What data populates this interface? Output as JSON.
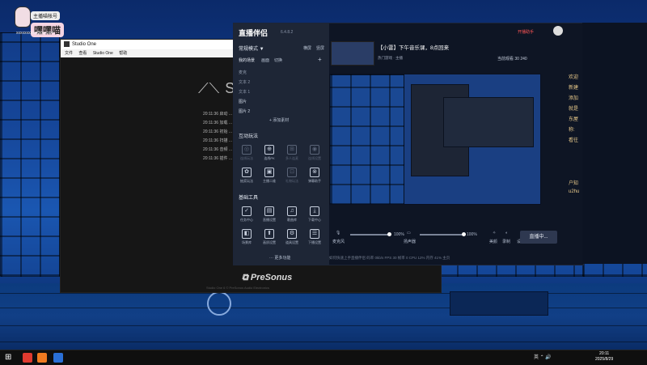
{
  "avatar": {
    "top_line": "主播喵帐号",
    "name": "嘿嘿喵",
    "email": "xxxxxxxxxx@qq.com"
  },
  "studio": {
    "title": "Studio One",
    "menu": [
      "文件",
      "查看",
      "Studio One",
      "帮助"
    ],
    "logo": "S",
    "logs": [
      "20:11:36  启动 ...",
      "20:11:36  加载 ...",
      "20:11:36  初始 ...",
      "20:11:36  扫描 ...",
      "20:11:36  音频 ...",
      "20:11:36  插件 ..."
    ],
    "brand": "PreSonus",
    "footer": "Studio One 6 © PreSonus Audio Electronics"
  },
  "live": {
    "logo": "直播伴侣",
    "version": "6.4.8.2",
    "mode": "常规模式 ▼",
    "mode_tabs": [
      "横屏",
      "竖屏"
    ],
    "scenes_label": "我的场景",
    "scene_tabs": [
      "画面",
      "切换"
    ],
    "scene_rows": [
      "麦克",
      "文本 2",
      "文本 1",
      "图片",
      "图片 2"
    ],
    "add_scene": "+ 添加素材",
    "interact_title": "互动玩法",
    "interact_tools": [
      {
        "icon": "◎",
        "label": "连线玩法",
        "dim": true
      },
      {
        "icon": "⊕",
        "label": "连线PK",
        "dim": false
      },
      {
        "icon": "⊞",
        "label": "多人连麦",
        "dim": true
      },
      {
        "icon": "◉",
        "label": "连线设置",
        "dim": true
      },
      {
        "icon": "✿",
        "label": "抽奖玩法",
        "dim": false
      },
      {
        "icon": "▣",
        "label": "主播二维",
        "dim": false
      },
      {
        "icon": "⊡",
        "label": "礼物玩法",
        "dim": true
      },
      {
        "icon": "⊗",
        "label": "弹幕助手",
        "dim": false
      }
    ],
    "basic_title": "基础工具",
    "basic_tools": [
      {
        "icon": "✓",
        "label": "任务中心",
        "dim": false
      },
      {
        "icon": "▤",
        "label": "直播设置",
        "dim": false
      },
      {
        "icon": "♫",
        "label": "歌曲库",
        "dim": false
      },
      {
        "icon": "⤓",
        "label": "下载中心",
        "dim": false
      },
      {
        "icon": "◧",
        "label": "场景库",
        "dim": false
      },
      {
        "icon": "⬆",
        "label": "画质设置",
        "dim": false
      },
      {
        "icon": "⚙",
        "label": "道具设置",
        "dim": false
      },
      {
        "icon": "☰",
        "label": "下播设置",
        "dim": false
      }
    ],
    "more": "··· 更多功能",
    "stream_title": "【小雷】下午音乐课，8点回来",
    "stream_sub": "热门游戏 · 主播",
    "stats": "当前观看 30    240",
    "controls": {
      "mic": "麦克风",
      "mic_pct": "100%",
      "speaker": "扬声器",
      "speaker_pct": "100%",
      "beauty": "美颜",
      "record": "录制",
      "settings": "设置"
    },
    "start": "直播中...",
    "status": "如何快速上手直播伴侣    码率 0kb/s    FPS 30    帧率 0    CPU 12%    内存 41%    主页"
  },
  "right": {
    "top1": "开播助手",
    "chat": [
      "欢迎",
      "新建",
      "添加",
      "就是",
      "东屋",
      "称:",
      "看往",
      "户知",
      "u2hu"
    ]
  },
  "taskbar": {
    "time": "20:11",
    "date": "2025/8/29",
    "tray": "英 ⌃ 🔊"
  }
}
